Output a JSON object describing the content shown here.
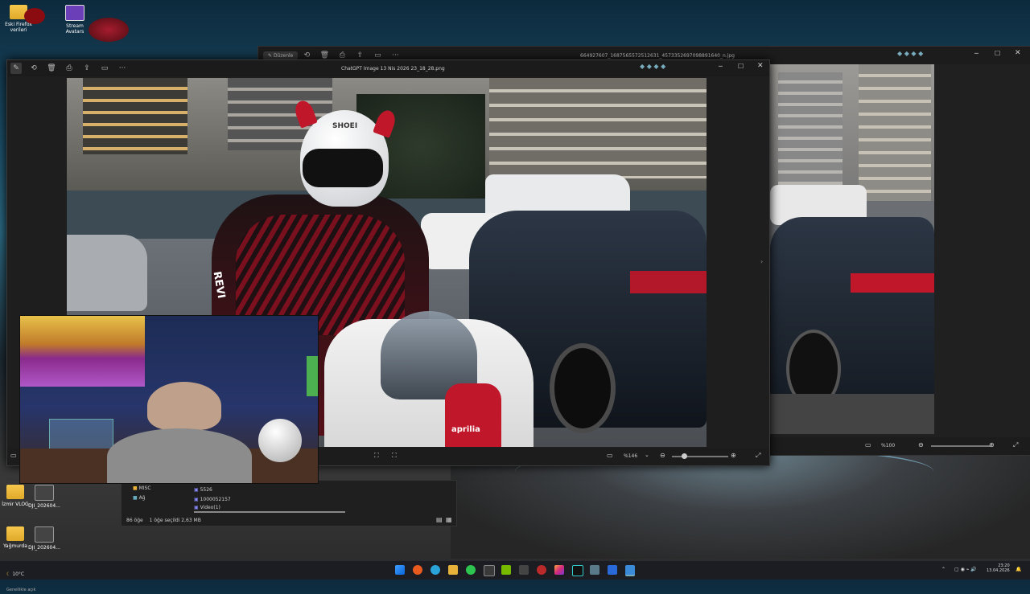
{
  "desktop": {
    "icons": [
      {
        "label": "Eski Firefox verileri",
        "kind": "folder"
      },
      {
        "label": "Stream Avatars",
        "kind": "app"
      },
      {
        "label": "İzmir VLOG",
        "kind": "folder"
      },
      {
        "label": "DJI_202604...",
        "kind": "video"
      },
      {
        "label": "Yağmurda",
        "kind": "folder"
      },
      {
        "label": "DJI_202604...",
        "kind": "video"
      }
    ]
  },
  "back_window": {
    "title": "664927607_1687565572512631_4573352697098891640_n.jpg",
    "edit_label": "Düzenle",
    "zoom": "%100"
  },
  "front_window": {
    "title": "ChatGPT Image 13 Nis 2026 23_18_28.png",
    "zoom": "%146",
    "photo_text": {
      "helmet": "SHOEI",
      "sleeve": "REVI",
      "bike": "aprilia"
    }
  },
  "explorer": {
    "sidebar": [
      "MISC",
      "Ağ"
    ],
    "files": [
      "5526",
      "1000052157",
      "Video(1)"
    ],
    "status_count": "86 öğe",
    "status_selected": "1 öğe seçildi  2,63 MB"
  },
  "taskbar": {
    "weather_temp": "10°C",
    "weather_desc": "Genellikle açık",
    "time": "23:20",
    "date": "13.04.2026"
  },
  "colors": {
    "accent_red": "#c0182a",
    "taskbar": "#1b1d22"
  }
}
